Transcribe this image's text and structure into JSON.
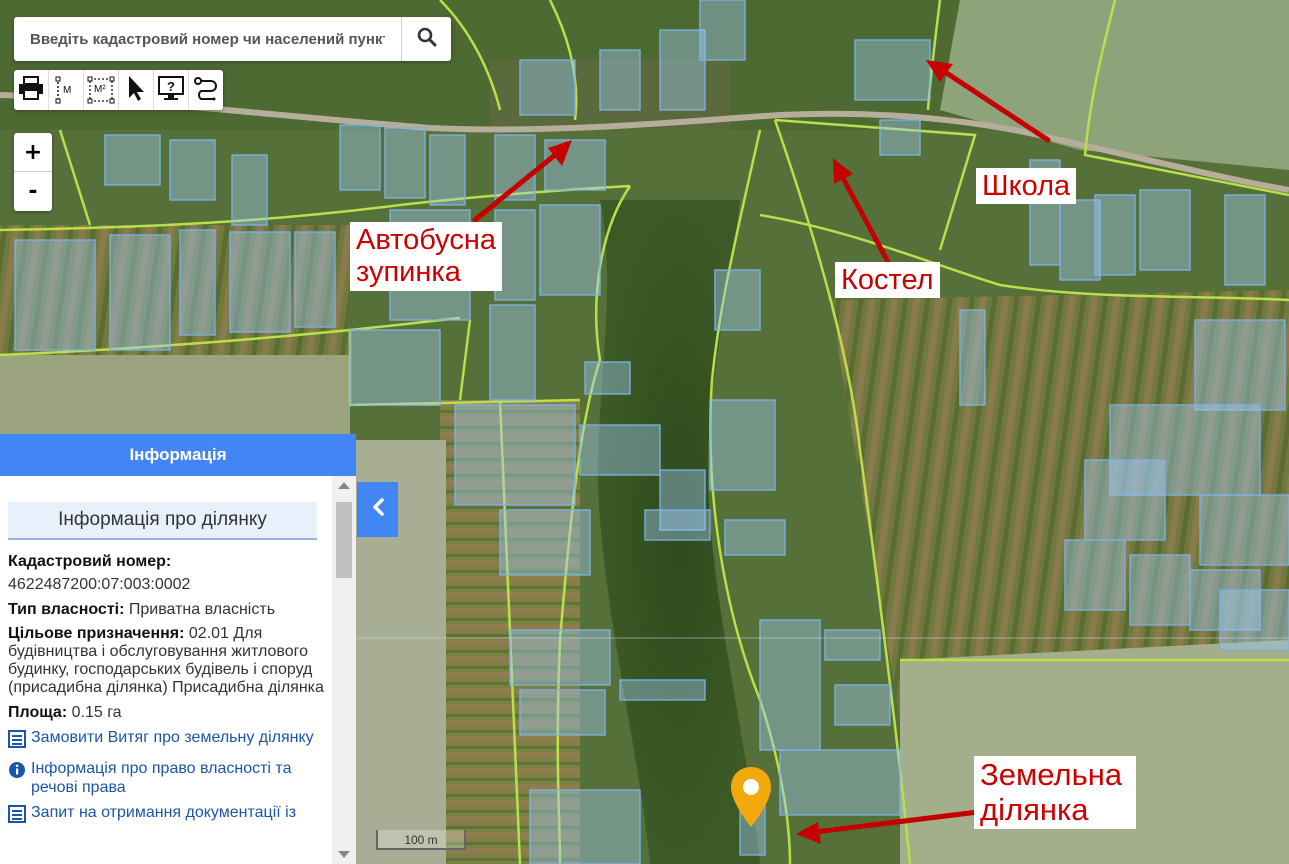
{
  "search": {
    "placeholder": "Введіть кадастровий номер чи населений пункт"
  },
  "toolbar": {
    "length_label": "М",
    "area_label": "М²"
  },
  "zoom": {
    "in_label": "+",
    "out_label": "-"
  },
  "annotations": {
    "bus_stop": "Автобусна\nзупинка",
    "school": "Школа",
    "church": "Костел",
    "land_plot": "Земельна\nділянка"
  },
  "panel": {
    "header": "Інформація",
    "section_title": "Інформація про ділянку",
    "cadastral_label": "Кадастровий номер:",
    "cadastral_value": "4622487200:07:003:0002",
    "ownership_label": "Тип власності:",
    "ownership_value": "Приватна власність",
    "purpose_label": "Цільове призначення:",
    "purpose_value": "02.01 Для будівництва і обслуговування житлового будинку, господарських будівель і споруд (присадибна ділянка) Присадибна ділянка",
    "area_label": "Площа:",
    "area_value": "0.15 га",
    "links": [
      "Замовити Витяг про земельну ділянку",
      "Інформація про право власності та речові права",
      "Запит на отримання документації із"
    ]
  },
  "scale": {
    "label": "100 m"
  },
  "colors": {
    "accent": "#4285f4",
    "annotation_text": "#c00000",
    "arrow": "#c40000",
    "parcel_fill": "#9ec9f0",
    "parcel_stroke": "#7ab3e6",
    "road_boundary": "#b8e04a",
    "marker": "#f2a90c"
  }
}
